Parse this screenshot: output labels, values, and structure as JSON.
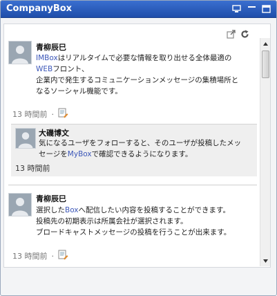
{
  "window": {
    "title": "CompanyBox",
    "icons": [
      "monitor-icon",
      "minimize-icon",
      "maximize-icon"
    ]
  },
  "toolbar": {
    "icons": [
      "popout-icon",
      "refresh-icon"
    ]
  },
  "posts": [
    {
      "author": "青柳辰巳",
      "body_prefix": "IMBox",
      "body_line1_rest": "はリアルタイムで必要な情報を取り出せる全体最適の",
      "body_line2_link": "WEB",
      "body_line2_rest": "フロント、",
      "body_line3": "企業内で発生するコミュニケーションメッセージの集積場所と",
      "body_line4": "なるソーシャル機能です。",
      "time": "13 時間前",
      "dot": "·",
      "reply": {
        "author": "大磯博文",
        "body_line1": "気になるユーザをフォローすると、そのユーザが投稿したメッ",
        "body_line2_prefix": "セージを",
        "body_line2_link": "MyBox",
        "body_line2_rest": "で確認できるようになります。",
        "time": "13 時間前"
      }
    },
    {
      "author": "青柳辰巳",
      "body_line1_prefix": "選択した",
      "body_line1_link": "Box",
      "body_line1_rest": "へ配信したい内容を投稿することができます。",
      "body_line2": "投稿先の初期表示は所属会社が選択されます。",
      "body_line3": "ブロードキャストメッセージの投稿を行うことが出来ます。",
      "time": "13 時間前",
      "dot": "·"
    }
  ],
  "colors": {
    "titlebar": "#2a5cc0",
    "link": "#3b56b8",
    "avatar": "#9aa6b2"
  }
}
